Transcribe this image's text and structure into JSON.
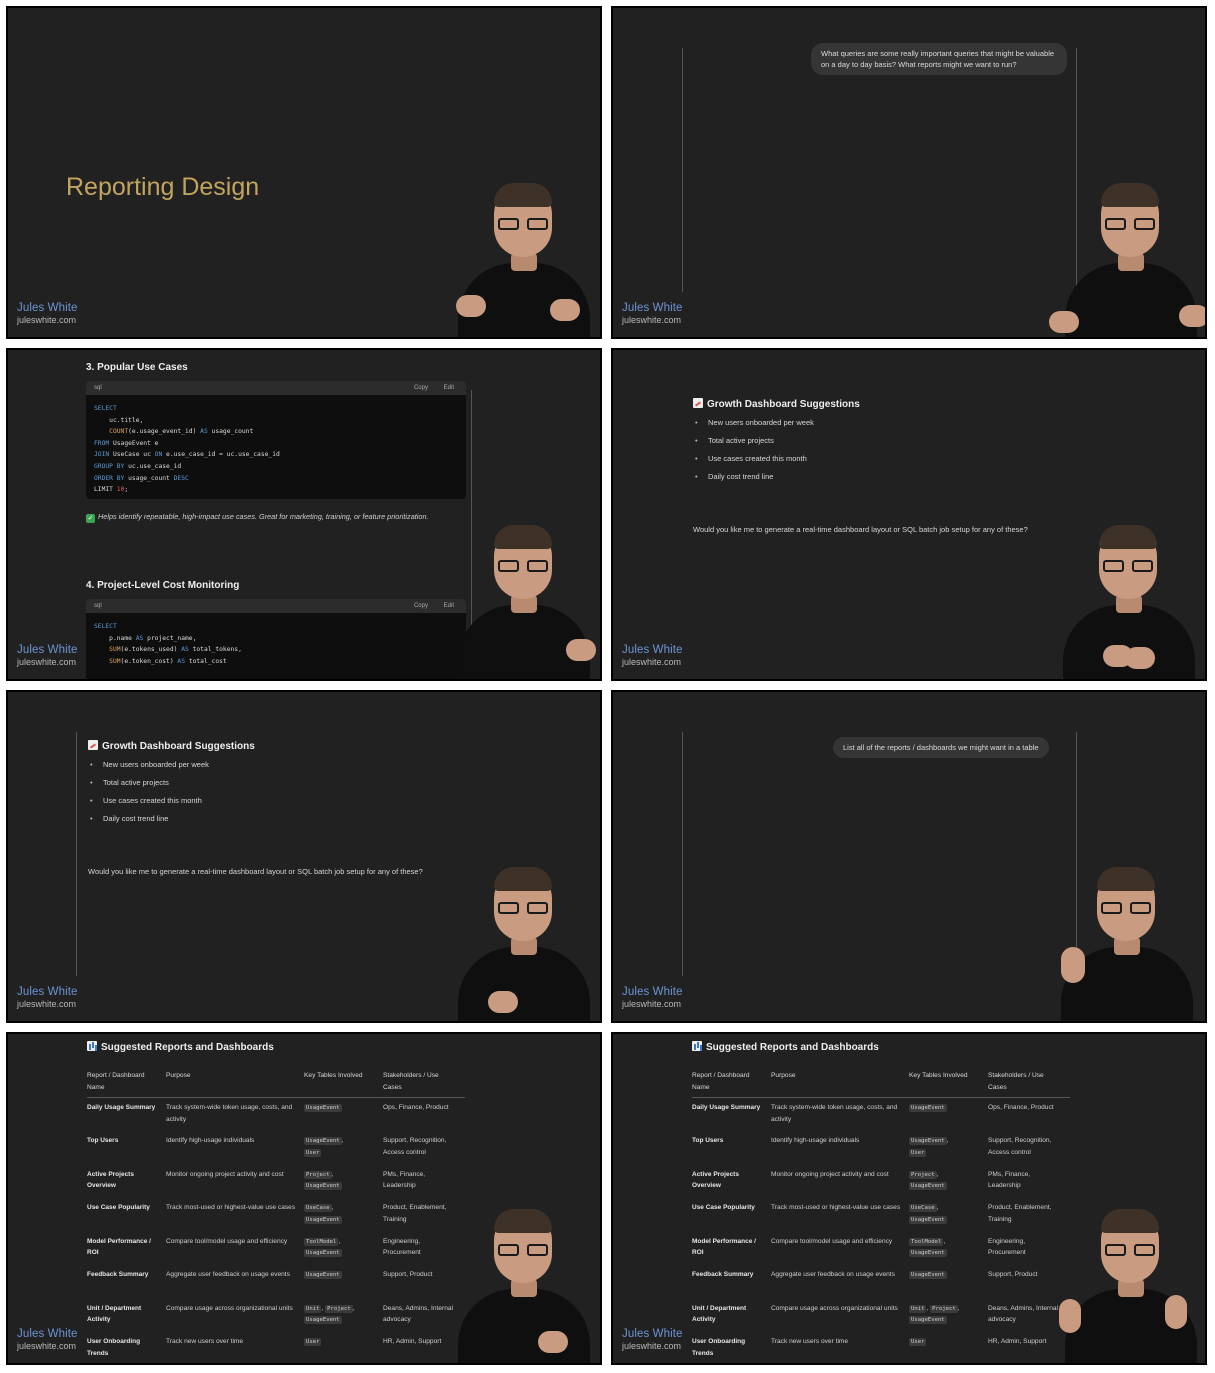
{
  "branding": {
    "name": "Jules White",
    "url": "juleswhite.com"
  },
  "frame1": {
    "title": "Reporting Design"
  },
  "frame2": {
    "prompt": "What queries are some really important queries that might be valuable on a day to day basis? What reports might we want to run?"
  },
  "frame3": {
    "section3_title": "3. Popular Use Cases",
    "section4_title": "4. Project-Level Cost Monitoring",
    "code_lang": "sql",
    "copy_label": "Copy",
    "edit_label": "Edit",
    "note": "Helps identify repeatable, high-impact use cases. Great for marketing, training, or feature prioritization."
  },
  "growth": {
    "title": "Growth Dashboard Suggestions",
    "items": [
      "New users onboarded per week",
      "Total active projects",
      "Use cases created this month",
      "Daily cost trend line"
    ],
    "question": "Would you like me to generate a real-time dashboard layout or SQL batch job setup for any of these?"
  },
  "frame6": {
    "prompt": "List all of the reports / dashboards we might want in a table"
  },
  "reports": {
    "title": "Suggested Reports and Dashboards",
    "headers": [
      "Report / Dashboard Name",
      "Purpose",
      "Key Tables Involved",
      "Stakeholders / Use Cases"
    ],
    "rows": [
      {
        "name": "Daily Usage Summary",
        "purpose": "Track system-wide token usage, costs, and activity",
        "tables": [
          "UsageEvent"
        ],
        "stakeholders": "Ops, Finance, Product"
      },
      {
        "name": "Top Users",
        "purpose": "Identify high-usage individuals",
        "tables": [
          "UsageEvent",
          "User"
        ],
        "stakeholders": "Support, Recognition, Access control"
      },
      {
        "name": "Active Projects Overview",
        "purpose": "Monitor ongoing project activity and cost",
        "tables": [
          "Project",
          "UsageEvent"
        ],
        "stakeholders": "PMs, Finance, Leadership"
      },
      {
        "name": "Use Case Popularity",
        "purpose": "Track most-used or highest-value use cases",
        "tables": [
          "UseCase",
          "UsageEvent"
        ],
        "stakeholders": "Product, Enablement, Training"
      },
      {
        "name": "Model Performance / ROI",
        "purpose": "Compare tool/model usage and efficiency",
        "tables": [
          "ToolModel",
          "UsageEvent"
        ],
        "stakeholders": "Engineering, Procurement"
      },
      {
        "name": "Feedback Summary",
        "purpose": "Aggregate user feedback on usage events",
        "tables": [
          "UsageEvent"
        ],
        "stakeholders": "Support, Product"
      },
      {
        "name": "Unit / Department Activity",
        "purpose": "Compare usage across organizational units",
        "tables": [
          "Unit",
          "Project",
          "UsageEvent"
        ],
        "stakeholders": "Deans, Admins, Internal advocacy"
      },
      {
        "name": "User Onboarding Trends",
        "purpose": "Track new users over time",
        "tables": [
          "User"
        ],
        "stakeholders": "HR, Admin, Support"
      }
    ]
  }
}
